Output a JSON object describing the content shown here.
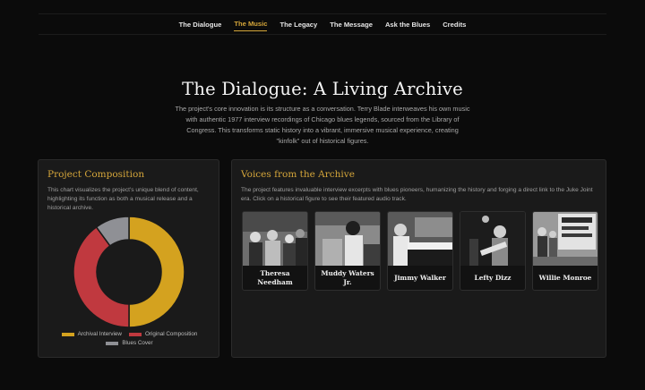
{
  "nav": {
    "items": [
      {
        "label": "The Dialogue"
      },
      {
        "label": "The Music"
      },
      {
        "label": "The Legacy"
      },
      {
        "label": "The Message"
      },
      {
        "label": "Ask the Blues"
      },
      {
        "label": "Credits"
      }
    ],
    "active": "The Music"
  },
  "hero": {
    "title": "The Dialogue: A Living Archive",
    "body": "The project's core innovation is its structure as a conversation. Terry Blade interweaves his own music with authentic 1977 interview recordings of Chicago blues legends, sourced from the Library of Congress. This transforms static history into a vibrant, immersive musical experience, creating \"kinfolk\" out of historical figures."
  },
  "composition": {
    "title": "Project Composition",
    "description": "This chart visualizes the project's unique blend of content, highlighting its function as both a musical release and a historical archive."
  },
  "chart_data": {
    "type": "pie",
    "categories": [
      "Archival Interview",
      "Original Composition",
      "Blues Cover"
    ],
    "values": [
      50,
      40,
      10
    ],
    "colors": [
      "#d4a21f",
      "#c0393f",
      "#8f9095"
    ],
    "legend_position": "bottom"
  },
  "voices": {
    "title": "Voices from the Archive",
    "description": "The project features invaluable interview excerpts with blues pioneers, humanizing the history and forging a direct link to the Juke Joint era. Click on a historical figure to see their featured audio track.",
    "figures": [
      {
        "name": "Theresa Needham"
      },
      {
        "name": "Muddy Waters Jr."
      },
      {
        "name": "Jimmy Walker"
      },
      {
        "name": "Lefty Dizz"
      },
      {
        "name": "Willie Monroe"
      }
    ]
  }
}
